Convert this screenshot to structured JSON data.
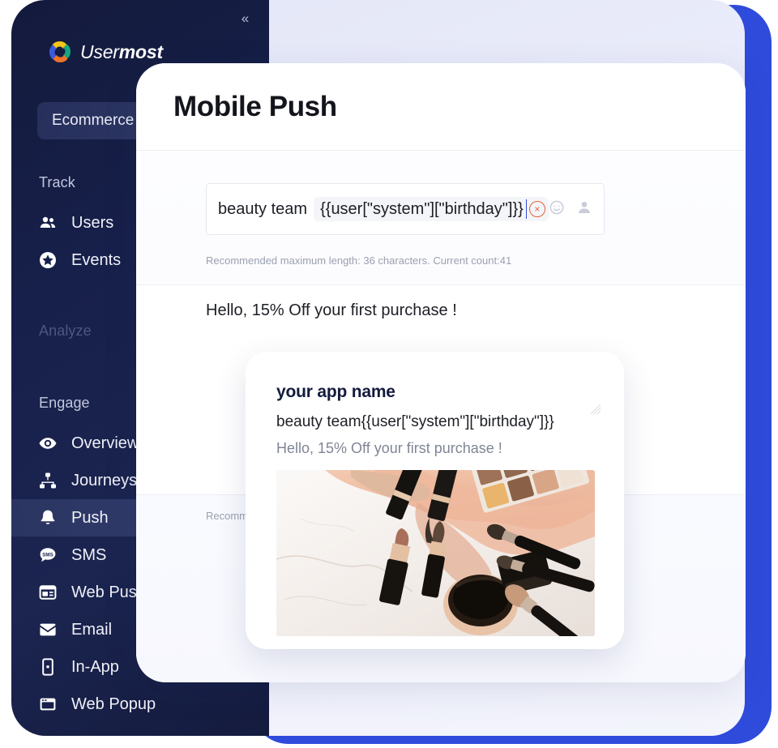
{
  "brand": {
    "name_light": "User",
    "name_bold": "most",
    "logo_icon": "usermost-pinwheel-logo",
    "colors": {
      "yellow": "#f5c518",
      "teal": "#17a67f",
      "blue": "#3b5bdb",
      "orange": "#f07329"
    }
  },
  "sidebar": {
    "collapse_icon": "«",
    "workspace": {
      "label": "Ecommerce"
    },
    "groups": [
      {
        "title": "Track",
        "dim": false,
        "items": [
          {
            "label": "Users",
            "icon": "users-icon",
            "active": false
          },
          {
            "label": "Events",
            "icon": "star-circle-icon",
            "active": false
          }
        ]
      },
      {
        "title": "Analyze",
        "dim": true,
        "items": []
      },
      {
        "title": "Engage",
        "dim": false,
        "items": [
          {
            "label": "Overview",
            "icon": "eye-icon",
            "active": false
          },
          {
            "label": "Journeys",
            "icon": "sitemap-icon",
            "active": false
          },
          {
            "label": "Push",
            "icon": "bell-icon",
            "active": true
          },
          {
            "label": "SMS",
            "icon": "sms-bubble-icon",
            "active": false
          },
          {
            "label": "Web Push",
            "icon": "browser-window-icon",
            "active": false
          },
          {
            "label": "Email",
            "icon": "envelope-icon",
            "active": false
          },
          {
            "label": "In-App",
            "icon": "mobile-phone-icon",
            "active": false
          },
          {
            "label": "Web Popup",
            "icon": "popup-window-icon",
            "active": false
          }
        ]
      }
    ]
  },
  "page": {
    "title": "Mobile Push"
  },
  "title_field": {
    "static_text": "beauty team",
    "token_text": "{{user[\"system\"][\"birthday\"]}}",
    "remove_icon": "×",
    "emoji_icon": "emoji-smiley-icon",
    "personalize_icon": "person-icon",
    "hint": "Recommended maximum length: 36 characters. Current count:41"
  },
  "message_field": {
    "value": "Hello, 15% Off your first purchase !",
    "hint_partial": "Recomm"
  },
  "preview": {
    "app_name": "your app name",
    "title": "beauty team{{user[\"system\"][\"birthday\"]}}",
    "body": "Hello, 15% Off your first purchase !",
    "image_alt": "makeup-cosmetics-flatlay-photo",
    "resize_icon": "resize-handle-icon"
  },
  "theme": {
    "backdrop_blue": "#2f4bdb",
    "sidebar_dark": "#131a3c",
    "accent_orange": "#e2623a",
    "caret_blue": "#2f4bdb"
  }
}
